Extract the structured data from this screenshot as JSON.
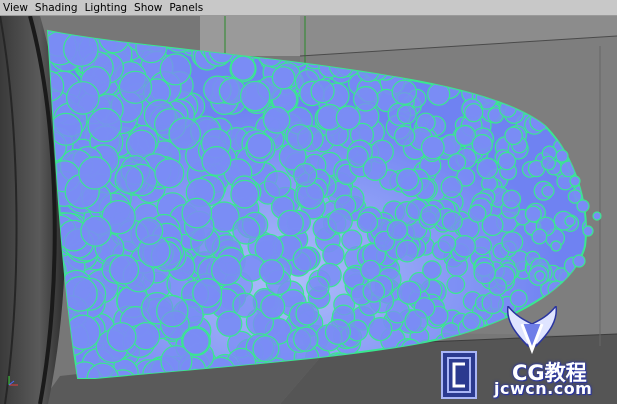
{
  "menubar": {
    "items": [
      {
        "label": "View"
      },
      {
        "label": "Shading"
      },
      {
        "label": "Lighting"
      },
      {
        "label": "Show"
      },
      {
        "label": "Panels"
      }
    ]
  },
  "viewport": {
    "background_color": "#6b6b6b",
    "particle_fill_color": "#7a8cf5",
    "particle_outline_color": "#39e88f",
    "axis_indicator": "view-axis-icon"
  },
  "watermark": {
    "brand": "CG教程",
    "url": "jcwcn.com",
    "logo": "winged-v-logo"
  }
}
